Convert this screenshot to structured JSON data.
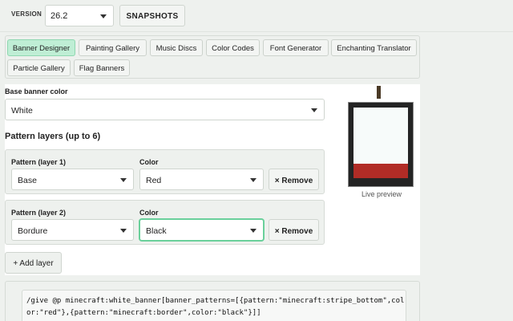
{
  "topbar": {
    "version_label": "VERSION",
    "version_value": "26.2",
    "snapshots_label": "SNAPSHOTS"
  },
  "tabs": [
    {
      "label": "Banner Designer",
      "active": true
    },
    {
      "label": "Painting Gallery",
      "active": false
    },
    {
      "label": "Music Discs",
      "active": false
    },
    {
      "label": "Color Codes",
      "active": false
    },
    {
      "label": "Font Generator",
      "active": false
    },
    {
      "label": "Enchanting Translator",
      "active": false
    },
    {
      "label": "Particle Gallery",
      "active": false
    },
    {
      "label": "Flag Banners",
      "active": false
    }
  ],
  "base": {
    "label": "Base banner color",
    "value": "White"
  },
  "layers_title": "Pattern layers (up to 6)",
  "layers": [
    {
      "pattern_label": "Pattern (layer 1)",
      "pattern_value": "Base",
      "color_label": "Color",
      "color_value": "Red",
      "remove_label": "× Remove"
    },
    {
      "pattern_label": "Pattern (layer 2)",
      "pattern_value": "Bordure",
      "color_label": "Color",
      "color_value": "Black",
      "remove_label": "× Remove"
    }
  ],
  "add_layer_label": "+ Add layer",
  "preview": {
    "caption": "Live preview",
    "banner_color": "#f7fbfa",
    "stripe_color": "#b12c26",
    "border_color": "#242424"
  },
  "command": "/give @p minecraft:white_banner[banner_patterns=[{pattern:\"minecraft:stripe_bottom\",color:\"red\"},{pattern:\"minecraft:border\",color:\"black\"}]]",
  "colors": {
    "accent": "#bfeed5",
    "focus": "#6ad09b"
  }
}
